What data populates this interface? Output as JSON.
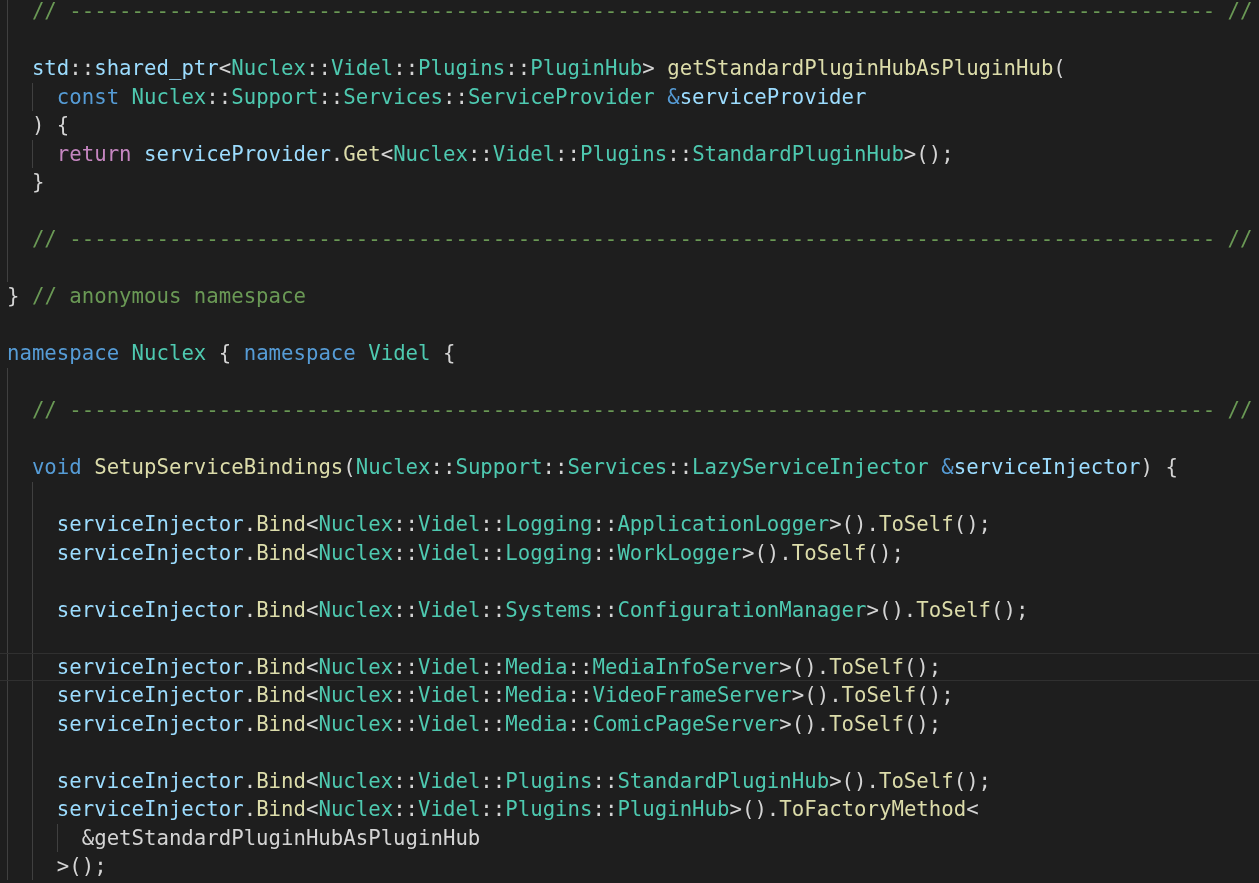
{
  "editor": {
    "lines": [
      {
        "current": false,
        "tokens": [
          {
            "kind": "cmt",
            "text": "  // -------------------------------------------------------------------------------------------- //"
          }
        ]
      },
      {
        "current": false
      },
      {
        "current": false,
        "tokens": [
          {
            "kind": "var",
            "text": "  std"
          },
          {
            "kind": "txt",
            "text": "::"
          },
          {
            "kind": "var",
            "text": "shared_ptr"
          },
          {
            "kind": "txt",
            "text": "<"
          },
          {
            "kind": "type",
            "text": "Nuclex"
          },
          {
            "kind": "txt",
            "text": "::"
          },
          {
            "kind": "type",
            "text": "Videl"
          },
          {
            "kind": "txt",
            "text": "::"
          },
          {
            "kind": "type",
            "text": "Plugins"
          },
          {
            "kind": "txt",
            "text": "::"
          },
          {
            "kind": "type",
            "text": "PluginHub"
          },
          {
            "kind": "txt",
            "text": "> "
          },
          {
            "kind": "fn",
            "text": "getStandardPluginHubAsPluginHub"
          },
          {
            "kind": "txt",
            "text": "("
          }
        ]
      },
      {
        "current": false,
        "tokens": [
          {
            "kind": "kw",
            "text": "    const "
          },
          {
            "kind": "type",
            "text": "Nuclex"
          },
          {
            "kind": "txt",
            "text": "::"
          },
          {
            "kind": "type",
            "text": "Support"
          },
          {
            "kind": "txt",
            "text": "::"
          },
          {
            "kind": "type",
            "text": "Services"
          },
          {
            "kind": "txt",
            "text": "::"
          },
          {
            "kind": "type",
            "text": "ServiceProvider "
          },
          {
            "kind": "kw",
            "text": "&"
          },
          {
            "kind": "var",
            "text": "serviceProvider"
          }
        ]
      },
      {
        "current": false,
        "tokens": [
          {
            "kind": "txt",
            "text": "  ) {"
          }
        ]
      },
      {
        "current": false,
        "tokens": [
          {
            "kind": "ctl",
            "text": "    return "
          },
          {
            "kind": "var",
            "text": "serviceProvider"
          },
          {
            "kind": "txt",
            "text": "."
          },
          {
            "kind": "fn",
            "text": "Get"
          },
          {
            "kind": "txt",
            "text": "<"
          },
          {
            "kind": "type",
            "text": "Nuclex"
          },
          {
            "kind": "txt",
            "text": "::"
          },
          {
            "kind": "type",
            "text": "Videl"
          },
          {
            "kind": "txt",
            "text": "::"
          },
          {
            "kind": "type",
            "text": "Plugins"
          },
          {
            "kind": "txt",
            "text": "::"
          },
          {
            "kind": "type",
            "text": "StandardPluginHub"
          },
          {
            "kind": "txt",
            "text": ">();"
          }
        ]
      },
      {
        "current": false,
        "tokens": [
          {
            "kind": "txt",
            "text": "  }"
          }
        ]
      },
      {
        "current": false
      },
      {
        "current": false,
        "tokens": [
          {
            "kind": "cmt",
            "text": "  // -------------------------------------------------------------------------------------------- //"
          }
        ]
      },
      {
        "current": false
      },
      {
        "current": false,
        "tokens": [
          {
            "kind": "txt",
            "text": "} "
          },
          {
            "kind": "cmt",
            "text": "// anonymous namespace"
          }
        ]
      },
      {
        "current": false
      },
      {
        "current": false,
        "tokens": [
          {
            "kind": "kw",
            "text": "namespace "
          },
          {
            "kind": "type",
            "text": "Nuclex"
          },
          {
            "kind": "txt",
            "text": " { "
          },
          {
            "kind": "kw",
            "text": "namespace "
          },
          {
            "kind": "type",
            "text": "Videl"
          },
          {
            "kind": "txt",
            "text": " {"
          }
        ]
      },
      {
        "current": false
      },
      {
        "current": false,
        "tokens": [
          {
            "kind": "cmt",
            "text": "  // -------------------------------------------------------------------------------------------- //"
          }
        ]
      },
      {
        "current": false
      },
      {
        "current": false,
        "tokens": [
          {
            "kind": "kw",
            "text": "  void "
          },
          {
            "kind": "fn",
            "text": "SetupServiceBindings"
          },
          {
            "kind": "txt",
            "text": "("
          },
          {
            "kind": "type",
            "text": "Nuclex"
          },
          {
            "kind": "txt",
            "text": "::"
          },
          {
            "kind": "type",
            "text": "Support"
          },
          {
            "kind": "txt",
            "text": "::"
          },
          {
            "kind": "type",
            "text": "Services"
          },
          {
            "kind": "txt",
            "text": "::"
          },
          {
            "kind": "type",
            "text": "LazyServiceInjector "
          },
          {
            "kind": "kw",
            "text": "&"
          },
          {
            "kind": "var",
            "text": "serviceInjector"
          },
          {
            "kind": "txt",
            "text": ") {"
          }
        ]
      },
      {
        "current": false
      },
      {
        "current": false,
        "tokens": [
          {
            "kind": "var",
            "text": "    serviceInjector"
          },
          {
            "kind": "txt",
            "text": "."
          },
          {
            "kind": "fn",
            "text": "Bind"
          },
          {
            "kind": "txt",
            "text": "<"
          },
          {
            "kind": "type",
            "text": "Nuclex"
          },
          {
            "kind": "txt",
            "text": "::"
          },
          {
            "kind": "type",
            "text": "Videl"
          },
          {
            "kind": "txt",
            "text": "::"
          },
          {
            "kind": "type",
            "text": "Logging"
          },
          {
            "kind": "txt",
            "text": "::"
          },
          {
            "kind": "type",
            "text": "ApplicationLogger"
          },
          {
            "kind": "txt",
            "text": ">()."
          },
          {
            "kind": "fn",
            "text": "ToSelf"
          },
          {
            "kind": "txt",
            "text": "();"
          }
        ]
      },
      {
        "current": false,
        "tokens": [
          {
            "kind": "var",
            "text": "    serviceInjector"
          },
          {
            "kind": "txt",
            "text": "."
          },
          {
            "kind": "fn",
            "text": "Bind"
          },
          {
            "kind": "txt",
            "text": "<"
          },
          {
            "kind": "type",
            "text": "Nuclex"
          },
          {
            "kind": "txt",
            "text": "::"
          },
          {
            "kind": "type",
            "text": "Videl"
          },
          {
            "kind": "txt",
            "text": "::"
          },
          {
            "kind": "type",
            "text": "Logging"
          },
          {
            "kind": "txt",
            "text": "::"
          },
          {
            "kind": "type",
            "text": "WorkLogger"
          },
          {
            "kind": "txt",
            "text": ">()."
          },
          {
            "kind": "fn",
            "text": "ToSelf"
          },
          {
            "kind": "txt",
            "text": "();"
          }
        ]
      },
      {
        "current": false
      },
      {
        "current": false,
        "tokens": [
          {
            "kind": "var",
            "text": "    serviceInjector"
          },
          {
            "kind": "txt",
            "text": "."
          },
          {
            "kind": "fn",
            "text": "Bind"
          },
          {
            "kind": "txt",
            "text": "<"
          },
          {
            "kind": "type",
            "text": "Nuclex"
          },
          {
            "kind": "txt",
            "text": "::"
          },
          {
            "kind": "type",
            "text": "Videl"
          },
          {
            "kind": "txt",
            "text": "::"
          },
          {
            "kind": "type",
            "text": "Systems"
          },
          {
            "kind": "txt",
            "text": "::"
          },
          {
            "kind": "type",
            "text": "ConfigurationManager"
          },
          {
            "kind": "txt",
            "text": ">()."
          },
          {
            "kind": "fn",
            "text": "ToSelf"
          },
          {
            "kind": "txt",
            "text": "();"
          }
        ]
      },
      {
        "current": false
      },
      {
        "current": true,
        "tokens": [
          {
            "kind": "var",
            "text": "    serviceInjector"
          },
          {
            "kind": "txt",
            "text": "."
          },
          {
            "kind": "fn",
            "text": "Bind"
          },
          {
            "kind": "txt",
            "text": "<"
          },
          {
            "kind": "type",
            "text": "Nuclex"
          },
          {
            "kind": "txt",
            "text": "::"
          },
          {
            "kind": "type",
            "text": "Videl"
          },
          {
            "kind": "txt",
            "text": "::"
          },
          {
            "kind": "type",
            "text": "Media"
          },
          {
            "kind": "txt",
            "text": "::"
          },
          {
            "kind": "type",
            "text": "MediaInfoServer"
          },
          {
            "kind": "txt",
            "text": ">()."
          },
          {
            "kind": "fn",
            "text": "ToSelf"
          },
          {
            "kind": "txt",
            "text": "();"
          }
        ]
      },
      {
        "current": false,
        "tokens": [
          {
            "kind": "var",
            "text": "    serviceInjector"
          },
          {
            "kind": "txt",
            "text": "."
          },
          {
            "kind": "fn",
            "text": "Bind"
          },
          {
            "kind": "txt",
            "text": "<"
          },
          {
            "kind": "type",
            "text": "Nuclex"
          },
          {
            "kind": "txt",
            "text": "::"
          },
          {
            "kind": "type",
            "text": "Videl"
          },
          {
            "kind": "txt",
            "text": "::"
          },
          {
            "kind": "type",
            "text": "Media"
          },
          {
            "kind": "txt",
            "text": "::"
          },
          {
            "kind": "type",
            "text": "VideoFrameServer"
          },
          {
            "kind": "txt",
            "text": ">()."
          },
          {
            "kind": "fn",
            "text": "ToSelf"
          },
          {
            "kind": "txt",
            "text": "();"
          }
        ]
      },
      {
        "current": false,
        "tokens": [
          {
            "kind": "var",
            "text": "    serviceInjector"
          },
          {
            "kind": "txt",
            "text": "."
          },
          {
            "kind": "fn",
            "text": "Bind"
          },
          {
            "kind": "txt",
            "text": "<"
          },
          {
            "kind": "type",
            "text": "Nuclex"
          },
          {
            "kind": "txt",
            "text": "::"
          },
          {
            "kind": "type",
            "text": "Videl"
          },
          {
            "kind": "txt",
            "text": "::"
          },
          {
            "kind": "type",
            "text": "Media"
          },
          {
            "kind": "txt",
            "text": "::"
          },
          {
            "kind": "type",
            "text": "ComicPageServer"
          },
          {
            "kind": "txt",
            "text": ">()."
          },
          {
            "kind": "fn",
            "text": "ToSelf"
          },
          {
            "kind": "txt",
            "text": "();"
          }
        ]
      },
      {
        "current": false
      },
      {
        "current": false,
        "tokens": [
          {
            "kind": "var",
            "text": "    serviceInjector"
          },
          {
            "kind": "txt",
            "text": "."
          },
          {
            "kind": "fn",
            "text": "Bind"
          },
          {
            "kind": "txt",
            "text": "<"
          },
          {
            "kind": "type",
            "text": "Nuclex"
          },
          {
            "kind": "txt",
            "text": "::"
          },
          {
            "kind": "type",
            "text": "Videl"
          },
          {
            "kind": "txt",
            "text": "::"
          },
          {
            "kind": "type",
            "text": "Plugins"
          },
          {
            "kind": "txt",
            "text": "::"
          },
          {
            "kind": "type",
            "text": "StandardPluginHub"
          },
          {
            "kind": "txt",
            "text": ">()."
          },
          {
            "kind": "fn",
            "text": "ToSelf"
          },
          {
            "kind": "txt",
            "text": "();"
          }
        ]
      },
      {
        "current": false,
        "tokens": [
          {
            "kind": "var",
            "text": "    serviceInjector"
          },
          {
            "kind": "txt",
            "text": "."
          },
          {
            "kind": "fn",
            "text": "Bind"
          },
          {
            "kind": "txt",
            "text": "<"
          },
          {
            "kind": "type",
            "text": "Nuclex"
          },
          {
            "kind": "txt",
            "text": "::"
          },
          {
            "kind": "type",
            "text": "Videl"
          },
          {
            "kind": "txt",
            "text": "::"
          },
          {
            "kind": "type",
            "text": "Plugins"
          },
          {
            "kind": "txt",
            "text": "::"
          },
          {
            "kind": "type",
            "text": "PluginHub"
          },
          {
            "kind": "txt",
            "text": ">()."
          },
          {
            "kind": "fn",
            "text": "ToFactoryMethod"
          },
          {
            "kind": "txt",
            "text": "<"
          }
        ]
      },
      {
        "current": false,
        "tokens": [
          {
            "kind": "txt",
            "text": "      &getStandardPluginHubAsPluginHub"
          }
        ]
      },
      {
        "current": false,
        "tokens": [
          {
            "kind": "txt",
            "text": "    >();"
          }
        ]
      }
    ]
  }
}
